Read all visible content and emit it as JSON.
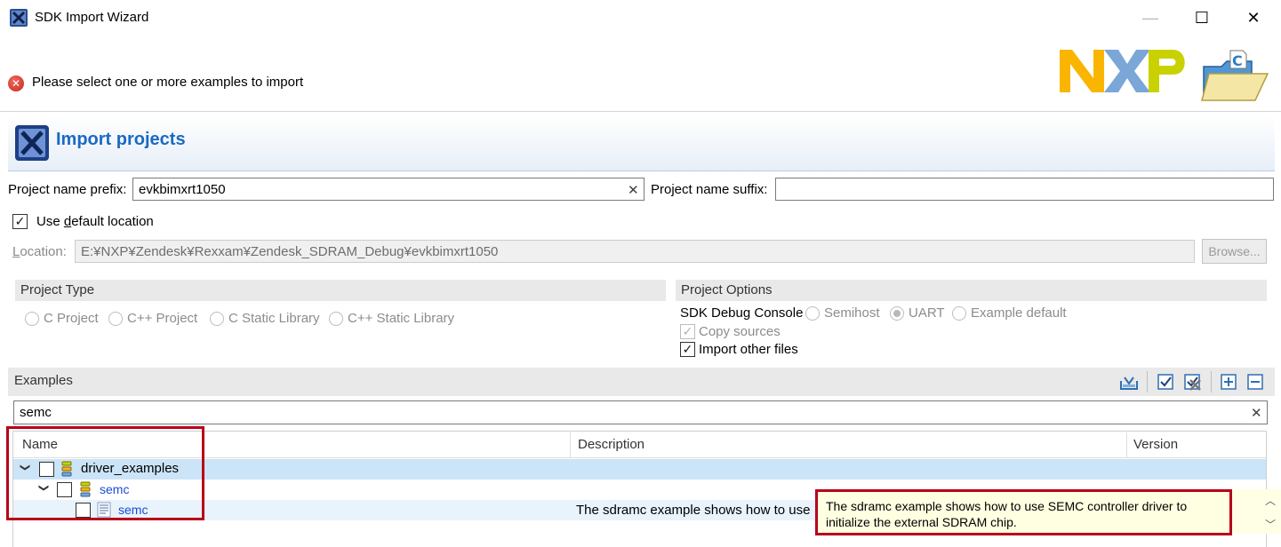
{
  "window": {
    "title": "SDK Import Wizard",
    "minimize_glyph": "—",
    "maximize_glyph": "☐",
    "close_glyph": "✕"
  },
  "message": {
    "icon": "error-icon",
    "text": "Please select one or more examples to import"
  },
  "banner": {
    "title": "Import projects"
  },
  "project_name": {
    "prefix_label": "Project name prefix:",
    "prefix_value": "evkbimxrt1050",
    "suffix_label": "Project name suffix:",
    "suffix_value": ""
  },
  "default_location": {
    "label_pre": "Use ",
    "label_mnemonic": "d",
    "label_post": "efault location",
    "checked": true
  },
  "location": {
    "label_mnemonic": "L",
    "label_post": "ocation:",
    "value": "E:¥NXP¥Zendesk¥Rexxam¥Zendesk_SDRAM_Debug¥evkbimxrt1050",
    "browse_label": "Browse..."
  },
  "project_type": {
    "title": "Project Type",
    "options": [
      "C Project",
      "C++ Project",
      "C Static Library",
      "C++ Static Library"
    ]
  },
  "project_options": {
    "title": "Project Options",
    "debug_console_label": "SDK Debug Console",
    "debug_options": [
      "Semihost",
      "UART",
      "Example default"
    ],
    "debug_selected": "UART",
    "copy_sources_label": "Copy sources",
    "copy_sources_checked": true,
    "import_other_label": "Import other files",
    "import_other_checked": true
  },
  "examples": {
    "title": "Examples",
    "filter_value": "semc",
    "toolbar_icons": [
      "import-icon",
      "check-all-icon",
      "uncheck-all-icon",
      "expand-all-icon",
      "collapse-all-icon"
    ],
    "columns": [
      "Name",
      "Description",
      "Version"
    ],
    "rows": [
      {
        "name": "driver_examples",
        "description": "",
        "version": ""
      },
      {
        "name": "semc",
        "description": "",
        "version": ""
      },
      {
        "name": "semc",
        "description": "The sdramc example shows how to use",
        "version": ""
      }
    ],
    "tooltip": "The sdramc example shows how to use SEMC controller driver to initialize the external SDRAM chip."
  },
  "colors": {
    "accent_blue": "#1a6ac4",
    "highlight_red": "#b8001a",
    "selected_row": "#cce4f7"
  }
}
